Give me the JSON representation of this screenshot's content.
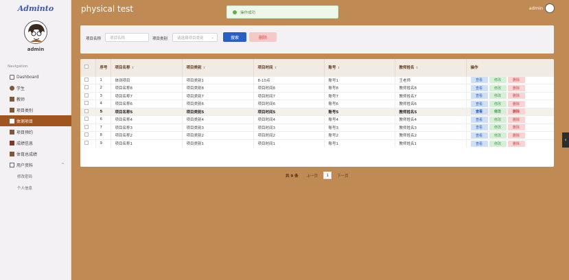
{
  "app": {
    "brand": "Adminto",
    "page_title": "physical test",
    "toast": "操作成功",
    "user": "admin"
  },
  "sidebar": {
    "username": "admin",
    "nav_heading": "Navigation",
    "items": [
      {
        "label": "Dashboard",
        "icon": "home-icon"
      },
      {
        "label": "学生",
        "icon": "user-icon"
      },
      {
        "label": "教师",
        "icon": "teacher-icon"
      },
      {
        "label": "项目类别",
        "icon": "category-icon"
      },
      {
        "label": "体测项目",
        "icon": "project-icon"
      },
      {
        "label": "项目预约",
        "icon": "calendar-icon"
      },
      {
        "label": "成绩信息",
        "icon": "flag-icon"
      },
      {
        "label": "体育总成绩",
        "icon": "score-icon"
      },
      {
        "label": "用户资料",
        "icon": "profile-icon"
      }
    ],
    "sub_items": [
      "修改密码",
      "个人信息"
    ]
  },
  "search": {
    "name_label": "项目名称",
    "name_placeholder": "项目名称",
    "type_label": "项目类别",
    "type_placeholder": "请选择项目类别",
    "search_btn": "搜索",
    "delete_btn": "删除"
  },
  "table": {
    "headers": [
      "序号",
      "项目名称",
      "项目类别",
      "项目时间",
      "账号",
      "教师姓名",
      "操作"
    ],
    "actions": {
      "view": "查看",
      "edit": "修改",
      "delete": "删除"
    },
    "rows": [
      [
        "1",
        "体测项目",
        "项目类别1",
        "8-10点",
        "账号1",
        "王老师"
      ],
      [
        "2",
        "项目名称8",
        "项目类别8",
        "项目时间8",
        "账号8",
        "教师姓名8"
      ],
      [
        "3",
        "项目名称7",
        "项目类别7",
        "项目时间7",
        "账号7",
        "教师姓名7"
      ],
      [
        "4",
        "项目名称6",
        "项目类别6",
        "项目时间6",
        "账号6",
        "教师姓名6"
      ],
      [
        "5",
        "项目名称5",
        "项目类别5",
        "项目时间5",
        "账号5",
        "教师姓名5"
      ],
      [
        "6",
        "项目名称4",
        "项目类别4",
        "项目时间4",
        "账号4",
        "教师姓名4"
      ],
      [
        "7",
        "项目名称3",
        "项目类别3",
        "项目时间3",
        "账号3",
        "教师姓名3"
      ],
      [
        "8",
        "项目名称2",
        "项目类别2",
        "项目时间2",
        "账号2",
        "教师姓名2"
      ],
      [
        "9",
        "项目名称1",
        "项目类别1",
        "项目时间1",
        "账号1",
        "教师姓名1"
      ]
    ]
  },
  "pager": {
    "total": "共 9 条",
    "prev": "上一页",
    "current": "1",
    "next": "下一页"
  },
  "colors": {
    "accent": "#c08a55",
    "active_nav": "#a0541f",
    "primary": "#2a5fc2"
  }
}
